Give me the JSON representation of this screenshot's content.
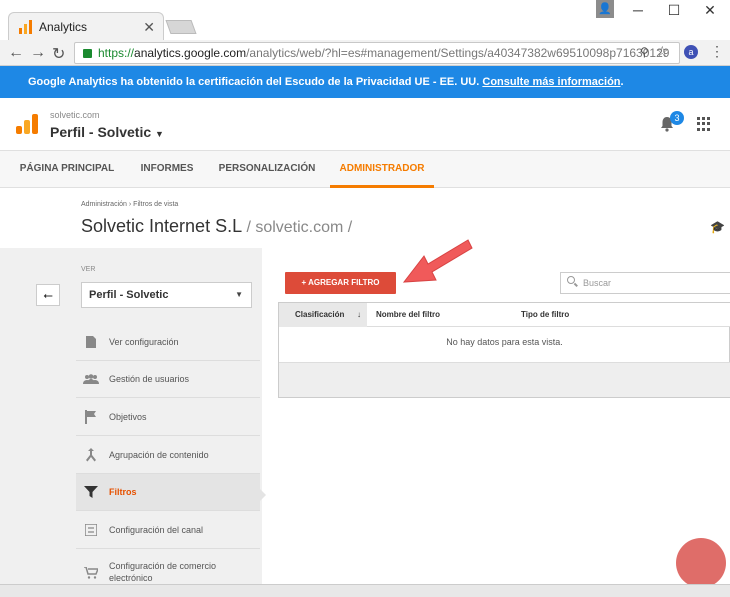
{
  "browser": {
    "tab_title": "Analytics",
    "url_https": "https://",
    "url_host": "analytics.google.com",
    "url_path": "/analytics/web/?hl=es#management/Settings/a40347382w69510098p71630129"
  },
  "banner": {
    "text": "Google Analytics ha obtenido la certificación del Escudo de la Privacidad UE - EE. UU.",
    "link": "Consulte más información",
    "end": "."
  },
  "header": {
    "domain": "solvetic.com",
    "property": "Perfil - Solvetic",
    "notif_count": "3"
  },
  "nav": {
    "tabs": [
      "PÁGINA PRINCIPAL",
      "INFORMES",
      "PERSONALIZACIÓN",
      "ADMINISTRADOR"
    ]
  },
  "page": {
    "breadcrumb": [
      "Administración",
      "›",
      "Filtros de vista"
    ],
    "title": "Solvetic Internet S.L",
    "subtitle": "/ solvetic.com /"
  },
  "sidebar": {
    "ver_label": "VER",
    "view_selected": "Perfil - Solvetic",
    "items": [
      {
        "label": "Ver configuración",
        "icon": "document-icon"
      },
      {
        "label": "Gestión de usuarios",
        "icon": "users-icon"
      },
      {
        "label": "Objetivos",
        "icon": "flag-icon"
      },
      {
        "label": "Agrupación de contenido",
        "icon": "merge-icon"
      },
      {
        "label": "Filtros",
        "icon": "filter-icon"
      },
      {
        "label": "Configuración del canal",
        "icon": "channel-icon"
      },
      {
        "label": "Configuración de comercio electrónico",
        "icon": "cart-icon"
      }
    ]
  },
  "main": {
    "add_button": "+ AGREGAR FILTRO",
    "search_placeholder": "Buscar",
    "columns": [
      "Clasificación",
      "Nombre del filtro",
      "Tipo de filtro"
    ],
    "empty_message": "No hay datos para esta vista."
  },
  "colors": {
    "banner": "#1e88e5",
    "accent": "#f57c00",
    "add_button": "#dd4b39",
    "arrow": "#f05a5a"
  }
}
